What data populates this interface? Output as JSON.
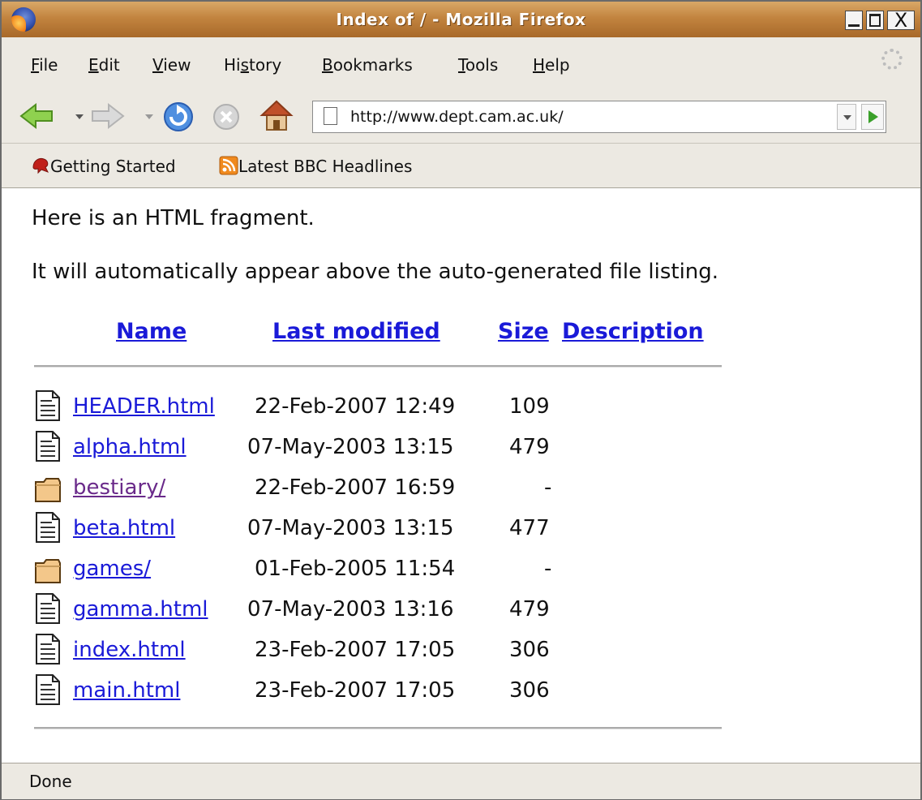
{
  "window": {
    "title": "Index of / - Mozilla Firefox",
    "close_glyph": "X"
  },
  "menu": [
    "File",
    "Edit",
    "View",
    "History",
    "Bookmarks",
    "Tools",
    "Help"
  ],
  "navigation": {
    "url": "http://www.dept.cam.ac.uk/",
    "icons": [
      "back-arrow-icon",
      "forward-arrow-icon",
      "reload-icon",
      "stop-icon",
      "home-icon"
    ]
  },
  "bookmarks": [
    {
      "label": "Getting Started",
      "icon": "firefox-bookmark-icon"
    },
    {
      "label": "Latest BBC Headlines",
      "icon": "rss-feed-icon"
    }
  ],
  "page": {
    "intro_1": "Here is an HTML fragment.",
    "intro_2": "It will automatically appear above the auto-generated file listing.",
    "columns": [
      "Name",
      "Last modified",
      "Size",
      "Description"
    ],
    "files": [
      {
        "name": "HEADER.html",
        "modified": "22-Feb-2007 12:49",
        "size": "109",
        "type": "file"
      },
      {
        "name": "alpha.html",
        "modified": "07-May-2003 13:15",
        "size": "479",
        "type": "file"
      },
      {
        "name": "bestiary/",
        "modified": "22-Feb-2007 16:59",
        "size": "-",
        "type": "folder",
        "visited": true
      },
      {
        "name": "beta.html",
        "modified": "07-May-2003 13:15",
        "size": "477",
        "type": "file"
      },
      {
        "name": "games/",
        "modified": "01-Feb-2005 11:54",
        "size": "-",
        "type": "folder"
      },
      {
        "name": "gamma.html",
        "modified": "07-May-2003 13:16",
        "size": "479",
        "type": "file"
      },
      {
        "name": "index.html",
        "modified": "23-Feb-2007 17:05",
        "size": "306",
        "type": "file"
      },
      {
        "name": "main.html",
        "modified": "23-Feb-2007 17:05",
        "size": "306",
        "type": "file"
      }
    ]
  },
  "status": "Done",
  "colors": {
    "link": "#1a1ad8",
    "visited_link": "#6a2a8a",
    "titlebar": "#c2843f",
    "chrome": "#ece9e2"
  }
}
